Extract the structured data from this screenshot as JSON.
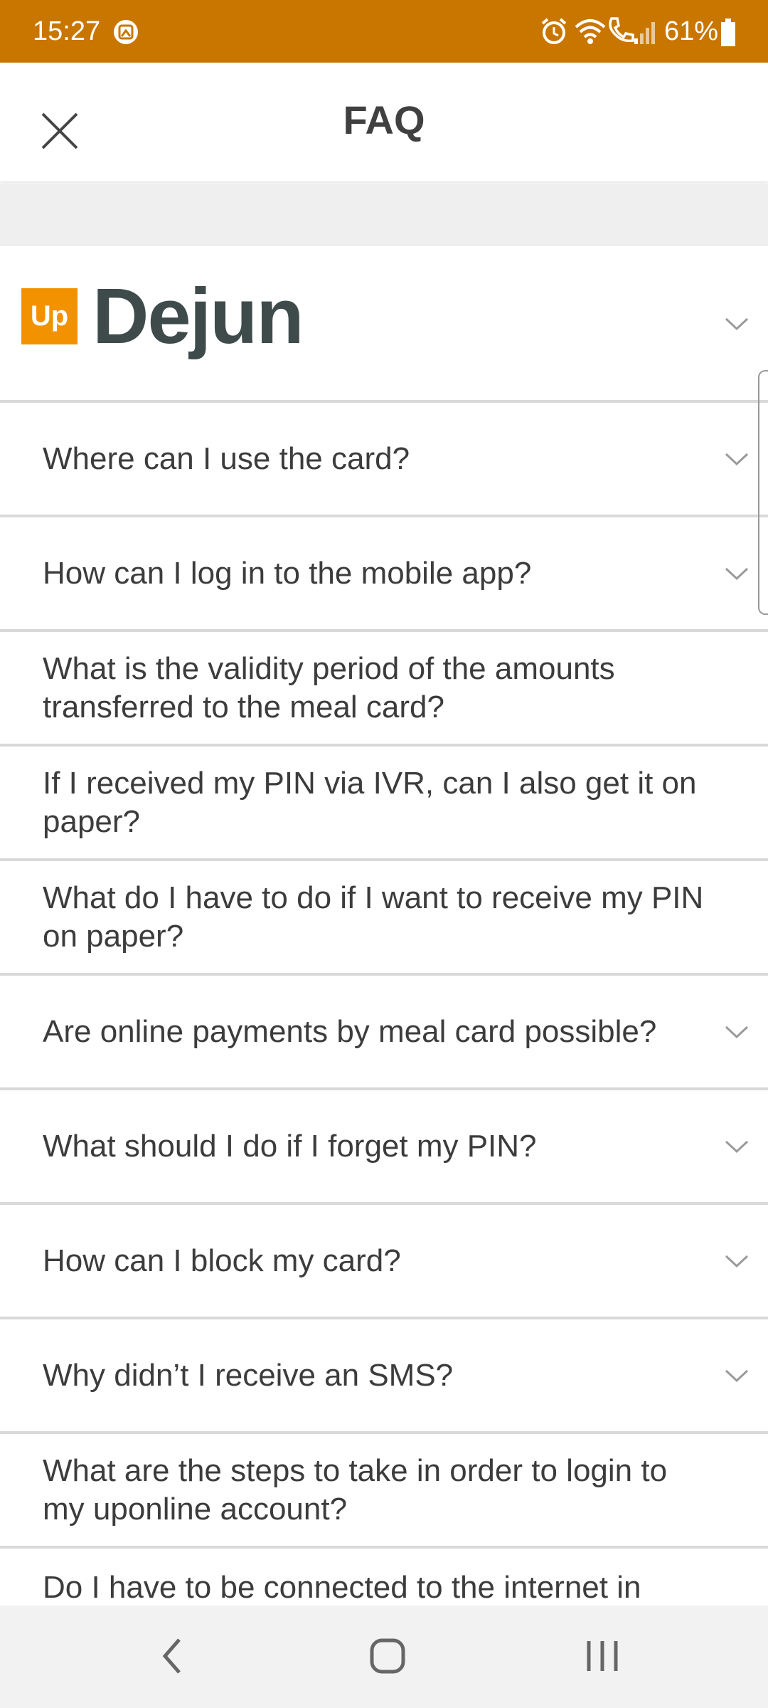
{
  "status_bar": {
    "time": "15:27",
    "battery": "61%",
    "icons": [
      "gallery-icon",
      "alarm-icon",
      "wifi-icon",
      "call-icon",
      "signal-icon",
      "battery-icon"
    ]
  },
  "header": {
    "title": "FAQ",
    "close_icon": "close-icon"
  },
  "brand": {
    "badge": "Up",
    "name": "Dejun",
    "badge_color": "#f39200",
    "name_color": "#3f4b4b"
  },
  "faq": {
    "items": [
      {
        "question": "Where can I use the card?",
        "has_chevron": true
      },
      {
        "question": "How can I log in to the mobile app?",
        "has_chevron": true
      },
      {
        "question": "What is the validity period of the amounts transferred to the meal card?",
        "has_chevron": false
      },
      {
        "question": "If I received my PIN via IVR, can I also get it on paper?",
        "has_chevron": false
      },
      {
        "question": "What do I have to do if I want to receive my PIN on paper?",
        "has_chevron": false
      },
      {
        "question": "Are online payments by meal card possible?",
        "has_chevron": true
      },
      {
        "question": "What should I do if I forget my PIN?",
        "has_chevron": true
      },
      {
        "question": "How can I block my card?",
        "has_chevron": true
      },
      {
        "question": "Why didn’t I receive an SMS?",
        "has_chevron": true
      },
      {
        "question": "What are the steps to take in order to login to my uponline account?",
        "has_chevron": false
      },
      {
        "question": "Do I have to be connected to the internet in order",
        "has_chevron": false
      }
    ]
  },
  "nav": {
    "back_icon": "back-icon",
    "home_icon": "home-icon",
    "recents_icon": "recents-icon"
  },
  "colors": {
    "status_bar": "#c87600",
    "divider": "#d9d9d9",
    "text": "#3c3c3c"
  }
}
